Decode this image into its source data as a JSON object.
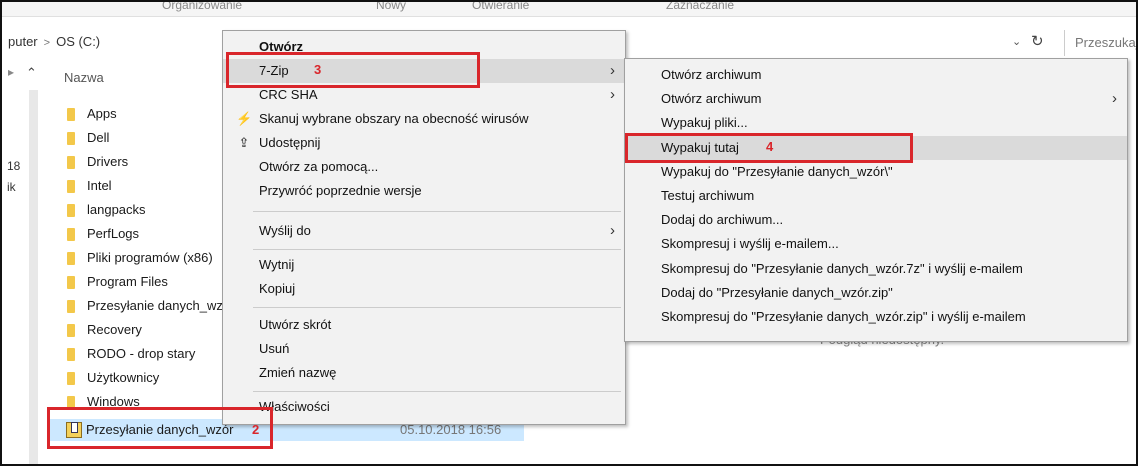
{
  "ribbon": [
    "Organizowanie",
    "Nowy",
    "Otwieranie",
    "Zaznaczanie"
  ],
  "address": {
    "crumbs": [
      "puter",
      "OS (C:)"
    ],
    "dropdown_glyph": "⌄",
    "refresh_glyph": "↻",
    "search_placeholder": "Przeszukaj"
  },
  "nav": {
    "collapse_glyph": "⌃",
    "marker1": "18",
    "marker2": "ik"
  },
  "files": {
    "header": "Nazwa",
    "items": [
      "Apps",
      "Dell",
      "Drivers",
      "Intel",
      "langpacks",
      "PerfLogs",
      "Pliki programów (x86)",
      "Program Files",
      "Przesyłanie danych_wz",
      "Recovery",
      "RODO - drop stary",
      "Użytkownicy",
      "Windows"
    ],
    "selected": {
      "name": "Przesyłanie danych_wzór",
      "date": "05.10.2018 16:56"
    },
    "preview_text": "Podgląd niedostępny."
  },
  "context_menu": {
    "items": [
      {
        "label": "Otwórz"
      },
      {
        "label": "7-Zip"
      },
      {
        "label": "CRC SHA"
      },
      {
        "label": "Skanuj wybrane obszary na obecność wirusów"
      },
      {
        "label": "Udostępnij"
      },
      {
        "label": "Otwórz za pomocą..."
      },
      {
        "label": "Przywróć poprzednie wersje"
      },
      {
        "label": "Wyślij do"
      },
      {
        "label": "Wytnij"
      },
      {
        "label": "Kopiuj"
      },
      {
        "label": "Utwórz skrót"
      },
      {
        "label": "Usuń"
      },
      {
        "label": "Zmień nazwę"
      },
      {
        "label": "Właściwości"
      }
    ]
  },
  "submenu": {
    "items": [
      {
        "label": "Otwórz archiwum"
      },
      {
        "label": "Otwórz archiwum"
      },
      {
        "label": "Wypakuj pliki..."
      },
      {
        "label": "Wypakuj tutaj"
      },
      {
        "label": "Wypakuj do \"Przesyłanie danych_wzór\\\""
      },
      {
        "label": "Testuj archiwum"
      },
      {
        "label": "Dodaj do archiwum..."
      },
      {
        "label": "Skompresuj i wyślij e-mailem..."
      },
      {
        "label": "Skompresuj do \"Przesyłanie danych_wzór.7z\" i wyślij e-mailem"
      },
      {
        "label": "Dodaj do \"Przesyłanie danych_wzór.zip\""
      },
      {
        "label": "Skompresuj do \"Przesyłanie danych_wzór.zip\" i wyślij e-mailem"
      }
    ]
  },
  "annotations": [
    "2",
    "3",
    "4"
  ],
  "colors": {
    "annotation_red": "#d9262b",
    "selection": "#cce8ff",
    "menu_bg": "#f2f2f2",
    "highlight": "#dadada",
    "folder": "#f3c84a"
  }
}
